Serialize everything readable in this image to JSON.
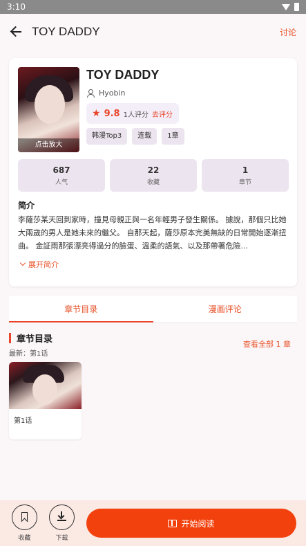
{
  "statusbar": {
    "time": "3:10"
  },
  "appbar": {
    "title": "TOY DADDY",
    "action": "讨论"
  },
  "comic": {
    "title": "TOY DADDY",
    "author": "Hyobin",
    "cover_zoom_label": "点击放大",
    "rating_score": "9.8",
    "rating_count": "1人评分",
    "rating_action": "去评分",
    "tags": [
      "韩漫Top3",
      "连载",
      "1章"
    ],
    "stats": [
      {
        "value": "687",
        "label": "人气"
      },
      {
        "value": "22",
        "label": "收藏"
      },
      {
        "value": "1",
        "label": "章节"
      }
    ],
    "intro_heading": "简介",
    "intro_text": "李薩莎某天回到家時，撞見母親正與一名年輕男子發生關係。 據說，那個只比她大兩歲的男人是她未來的繼父。 自那天起，薩莎原本完美無缺的日常開始逐漸扭曲。 金証雨那張漂亮得過分的臉蛋、溫柔的語氣、以及那帶著危險...",
    "expand_label": "展开简介"
  },
  "tabs": [
    {
      "label": "章节目录",
      "active": true
    },
    {
      "label": "漫画评论",
      "active": false
    }
  ],
  "chapters": {
    "heading": "章节目录",
    "latest": "最新：第1话",
    "view_all": "查看全部 1 章",
    "items": [
      {
        "name": "第1话"
      }
    ]
  },
  "bottom": {
    "favorite_label": "收藏",
    "download_label": "下载",
    "read_label": "开始阅读"
  },
  "colors": {
    "accent": "#e8452a",
    "primary_button": "#f2410c",
    "chip_bg": "#ece4ef"
  },
  "icons": [
    "back-arrow-icon",
    "person-icon",
    "star-icon",
    "chevron-down-icon",
    "bookmark-icon",
    "download-icon",
    "book-icon",
    "wifi-icon",
    "battery-icon"
  ]
}
